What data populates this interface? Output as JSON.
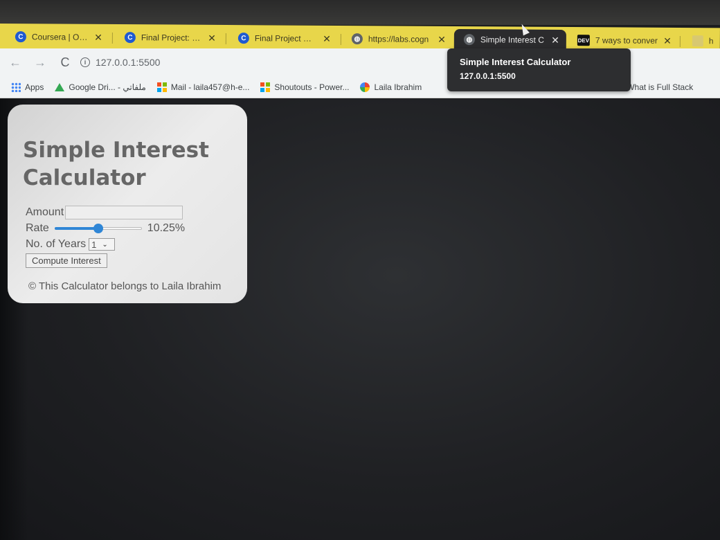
{
  "browser": {
    "tabs": [
      {
        "favicon": "coursera-icon",
        "title": "Coursera | Online",
        "active": false
      },
      {
        "favicon": "coursera-icon",
        "title": "Final Project: Sub",
        "active": false
      },
      {
        "favicon": "coursera-icon",
        "title": "Final Project Ove",
        "active": false
      },
      {
        "favicon": "globe-icon",
        "title": "https://labs.cogn",
        "active": false
      },
      {
        "favicon": "globe-icon",
        "title": "Simple Interest C",
        "active": true
      },
      {
        "favicon": "dev-icon",
        "title": "7 ways to conver",
        "active": false
      },
      {
        "favicon": "document-icon",
        "title": "html",
        "active": false
      }
    ],
    "close_glyph": "✕",
    "back_glyph": "←",
    "forward_glyph": "→",
    "reload_glyph": "C",
    "info_glyph": "i",
    "address": "127.0.0.1:5500",
    "bookmarks": [
      {
        "icon": "apps-icon",
        "label": "Apps"
      },
      {
        "icon": "google-drive-icon",
        "label": "Google Dri... - ملفاتي"
      },
      {
        "icon": "microsoft-icon",
        "label": "Mail - laila457@h-e..."
      },
      {
        "icon": "microsoft-icon",
        "label": "Shoutouts - Power..."
      },
      {
        "icon": "pinwheel-icon",
        "label": "Laila Ibrahim"
      },
      {
        "icon": "w-icon",
        "label": "What is Full Stack"
      }
    ],
    "tooltip": {
      "title": "Simple Interest Calculator",
      "url": "127.0.0.1:5500"
    }
  },
  "calculator": {
    "heading": "Simple Interest Calculator",
    "amount_label": "Amount",
    "amount_value": "",
    "rate_label": "Rate",
    "rate_value": "10.25%",
    "rate_fraction": 0.5,
    "years_label": "No. of Years",
    "years_value": "1",
    "compute_button": "Compute Interest",
    "footer": "© This Calculator belongs to Laila Ibrahim"
  },
  "colors": {
    "tabstrip": "#e8d64a",
    "accent": "#2f86d6"
  }
}
